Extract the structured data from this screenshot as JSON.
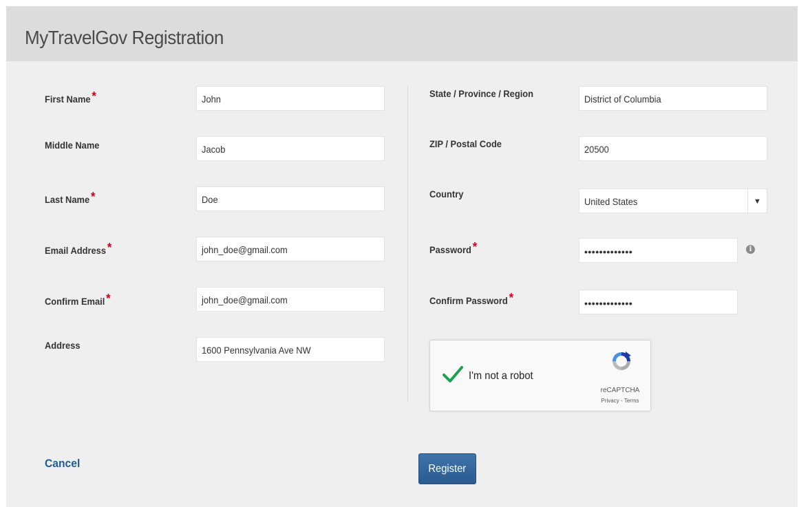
{
  "header": {
    "title": "MyTravelGov Registration"
  },
  "required_marker": "*",
  "left": {
    "first_name": {
      "label": "First Name",
      "value": "John"
    },
    "middle_name": {
      "label": "Middle Name",
      "value": "Jacob"
    },
    "last_name": {
      "label": "Last Name",
      "value": "Doe"
    },
    "email": {
      "label": "Email Address",
      "value": "john_doe@gmail.com"
    },
    "confirm_email": {
      "label": "Confirm Email",
      "value": "john_doe@gmail.com"
    },
    "address": {
      "label": "Address",
      "value": "1600 Pennsylvania Ave NW"
    }
  },
  "right": {
    "state": {
      "label": "State / Province / Region",
      "value": "District of Columbia"
    },
    "zip": {
      "label": "ZIP / Postal Code",
      "value": "20500"
    },
    "country": {
      "label": "Country",
      "value": "United States"
    },
    "password": {
      "label": "Password",
      "value": "•••••••••••••"
    },
    "confirm_password": {
      "label": "Confirm Password",
      "value": "•••••••••••••"
    }
  },
  "captcha": {
    "label": "I'm not a robot",
    "brand": "reCAPTCHA",
    "links": "Privacy - Terms",
    "checked": true
  },
  "actions": {
    "cancel": "Cancel",
    "register": "Register"
  },
  "icons": {
    "info": "info-icon",
    "dropdown": "chevron-down-icon",
    "check": "checkmark-icon"
  },
  "colors": {
    "required": "#d0021b",
    "link": "#1f5c99",
    "primary": "#2e6299",
    "check": "#1aa14b"
  }
}
